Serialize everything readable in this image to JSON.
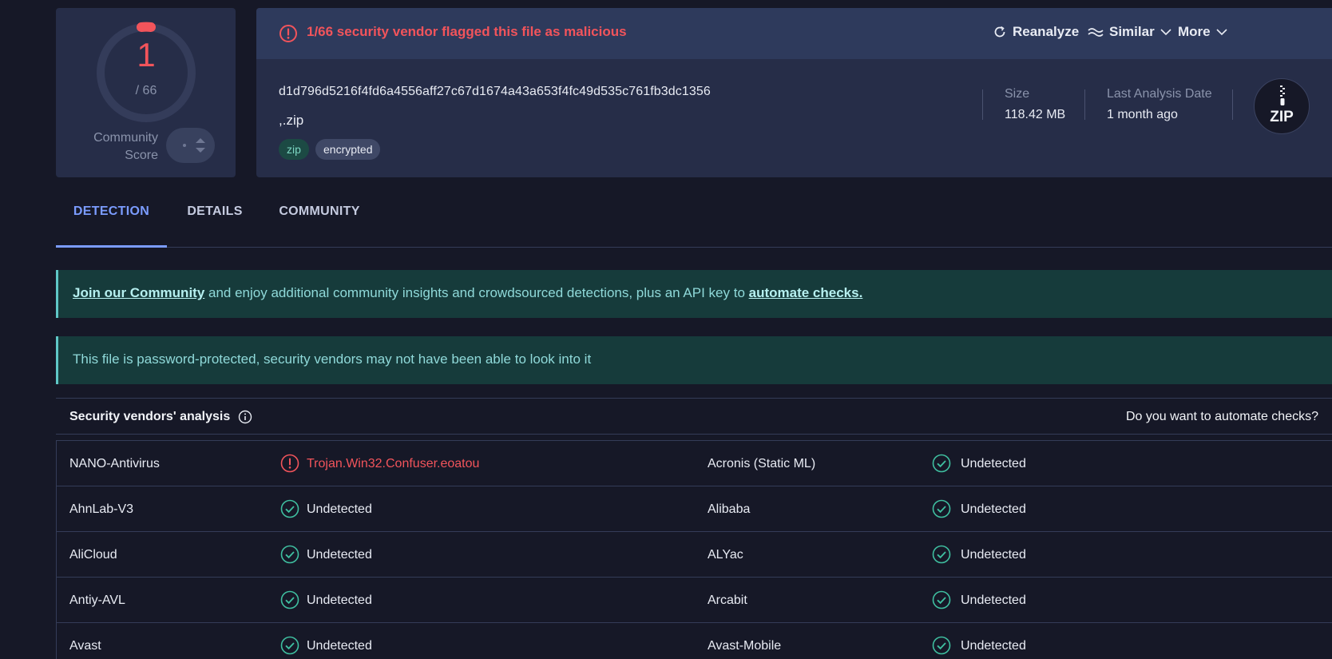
{
  "score": {
    "detections": "1",
    "total": "/ 66",
    "community_label": "Community Score",
    "colors": {
      "accent": "#f2545b",
      "ring": "#343c5a"
    }
  },
  "alert": {
    "text": "1/66 security vendor flagged this file as malicious",
    "actions": {
      "reanalyze": "Reanalyze",
      "similar": "Similar",
      "more": "More"
    }
  },
  "file": {
    "hash": "d1d796d5216f4fd6a4556aff27c67d1674a43a653f4fc49d535c761fb3dc1356",
    "name": ",.zip",
    "tags": [
      "zip",
      "encrypted"
    ],
    "size_label": "Size",
    "size_value": "118.42 MB",
    "date_label": "Last Analysis Date",
    "date_value": "1 month ago",
    "type_badge": "ZIP"
  },
  "tabs": [
    "DETECTION",
    "DETAILS",
    "COMMUNITY"
  ],
  "banners": {
    "community": {
      "link1": "Join our Community",
      "middle": " and enjoy additional community insights and crowdsourced detections, plus an API key to ",
      "link2": "automate checks."
    },
    "password": "This file is password-protected, security vendors may not have been able to look into it"
  },
  "vendors": {
    "title": "Security vendors' analysis",
    "cta": "Do you want to automate checks?",
    "rows": [
      {
        "left": {
          "name": "NANO-Antivirus",
          "result": "Trojan.Win32.Confuser.eoatou",
          "status": "malicious"
        },
        "right": {
          "name": "Acronis (Static ML)",
          "result": "Undetected",
          "status": "undetected"
        }
      },
      {
        "left": {
          "name": "AhnLab-V3",
          "result": "Undetected",
          "status": "undetected"
        },
        "right": {
          "name": "Alibaba",
          "result": "Undetected",
          "status": "undetected"
        }
      },
      {
        "left": {
          "name": "AliCloud",
          "result": "Undetected",
          "status": "undetected"
        },
        "right": {
          "name": "ALYac",
          "result": "Undetected",
          "status": "undetected"
        }
      },
      {
        "left": {
          "name": "Antiy-AVL",
          "result": "Undetected",
          "status": "undetected"
        },
        "right": {
          "name": "Arcabit",
          "result": "Undetected",
          "status": "undetected"
        }
      },
      {
        "left": {
          "name": "Avast",
          "result": "Undetected",
          "status": "undetected"
        },
        "right": {
          "name": "Avast-Mobile",
          "result": "Undetected",
          "status": "undetected"
        }
      }
    ]
  }
}
